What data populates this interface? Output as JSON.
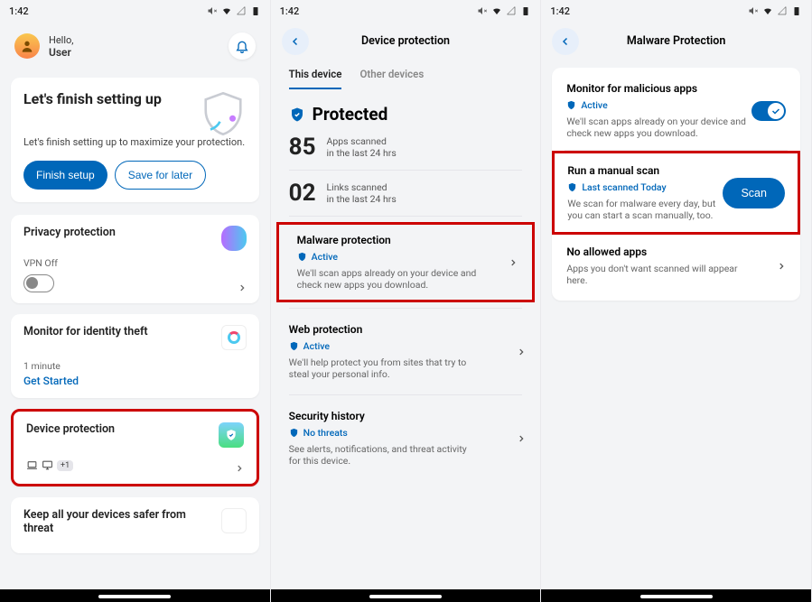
{
  "status": {
    "time": "1:42",
    "icons": [
      "mute",
      "wifi",
      "signal",
      "battery"
    ]
  },
  "screen1": {
    "greeting_label": "Hello,",
    "greeting_name": "User",
    "setup": {
      "title": "Let's finish setting up",
      "subtitle": "Let's finish setting up to maximize your protection.",
      "finish_btn": "Finish setup",
      "later_btn": "Save for later"
    },
    "privacy": {
      "title": "Privacy protection",
      "sub": "VPN Off"
    },
    "identity": {
      "title": "Monitor for identity theft",
      "time": "1 minute",
      "cta": "Get Started"
    },
    "device": {
      "title": "Device protection",
      "extra": "+1"
    },
    "threat": {
      "title": "Keep all your devices safer from threat"
    }
  },
  "screen2": {
    "title": "Device protection",
    "tabs": {
      "this": "This device",
      "other": "Other devices"
    },
    "status": "Protected",
    "stats": [
      {
        "num": "85",
        "label": "Apps scanned",
        "sub": "in the last 24 hrs"
      },
      {
        "num": "02",
        "label": "Links scanned",
        "sub": "in the last 24 hrs"
      }
    ],
    "items": {
      "malware": {
        "title": "Malware protection",
        "status": "Active",
        "desc": "We'll scan apps already on your device and check new apps you download."
      },
      "web": {
        "title": "Web protection",
        "status": "Active",
        "desc": "We'll help protect you from sites that try to steal your personal info."
      },
      "history": {
        "title": "Security history",
        "status": "No threats",
        "desc": "See alerts, notifications, and threat activity for this device."
      }
    }
  },
  "screen3": {
    "title": "Malware Protection",
    "monitor": {
      "title": "Monitor for malicious apps",
      "status": "Active",
      "desc": "We'll scan apps already on your device and check new apps you download."
    },
    "manual": {
      "title": "Run a manual scan",
      "status": "Last scanned Today",
      "desc": "We scan for malware every day, but you can start a scan manually, too.",
      "btn": "Scan"
    },
    "allowed": {
      "title": "No allowed apps",
      "desc": "Apps you don't want scanned will appear here."
    }
  }
}
